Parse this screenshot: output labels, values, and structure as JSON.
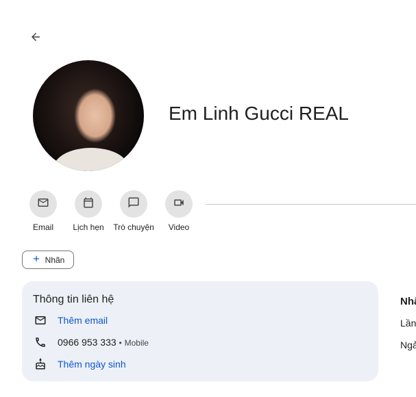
{
  "icons": {
    "back": "arrow-back-icon",
    "email": "mail-icon",
    "calendar": "calendar-icon",
    "chat": "chat-icon",
    "video": "video-icon",
    "add": "plus-icon",
    "phone": "phone-icon",
    "birthday": "cake-icon"
  },
  "contact": {
    "name": "Em Linh Gucci REAL"
  },
  "actions": [
    {
      "label": "Email"
    },
    {
      "label": "Lịch hẹn"
    },
    {
      "label": "Trò chuyện"
    },
    {
      "label": "Video"
    }
  ],
  "label_button": "Nhãn",
  "contact_info": {
    "title": "Thông tin liên hệ",
    "add_email": "Thêm email",
    "phone": "0966 953 333",
    "phone_sep": "•",
    "phone_type": "Mobile",
    "add_birthday": "Thêm ngày sinh"
  },
  "side_panel": {
    "title": "Nhâ",
    "line1": "Lần",
    "line2": "Ngả"
  },
  "colors": {
    "accent": "#0b57d0",
    "card_bg": "#edf0f6",
    "action_bg": "#e3e3e3"
  }
}
